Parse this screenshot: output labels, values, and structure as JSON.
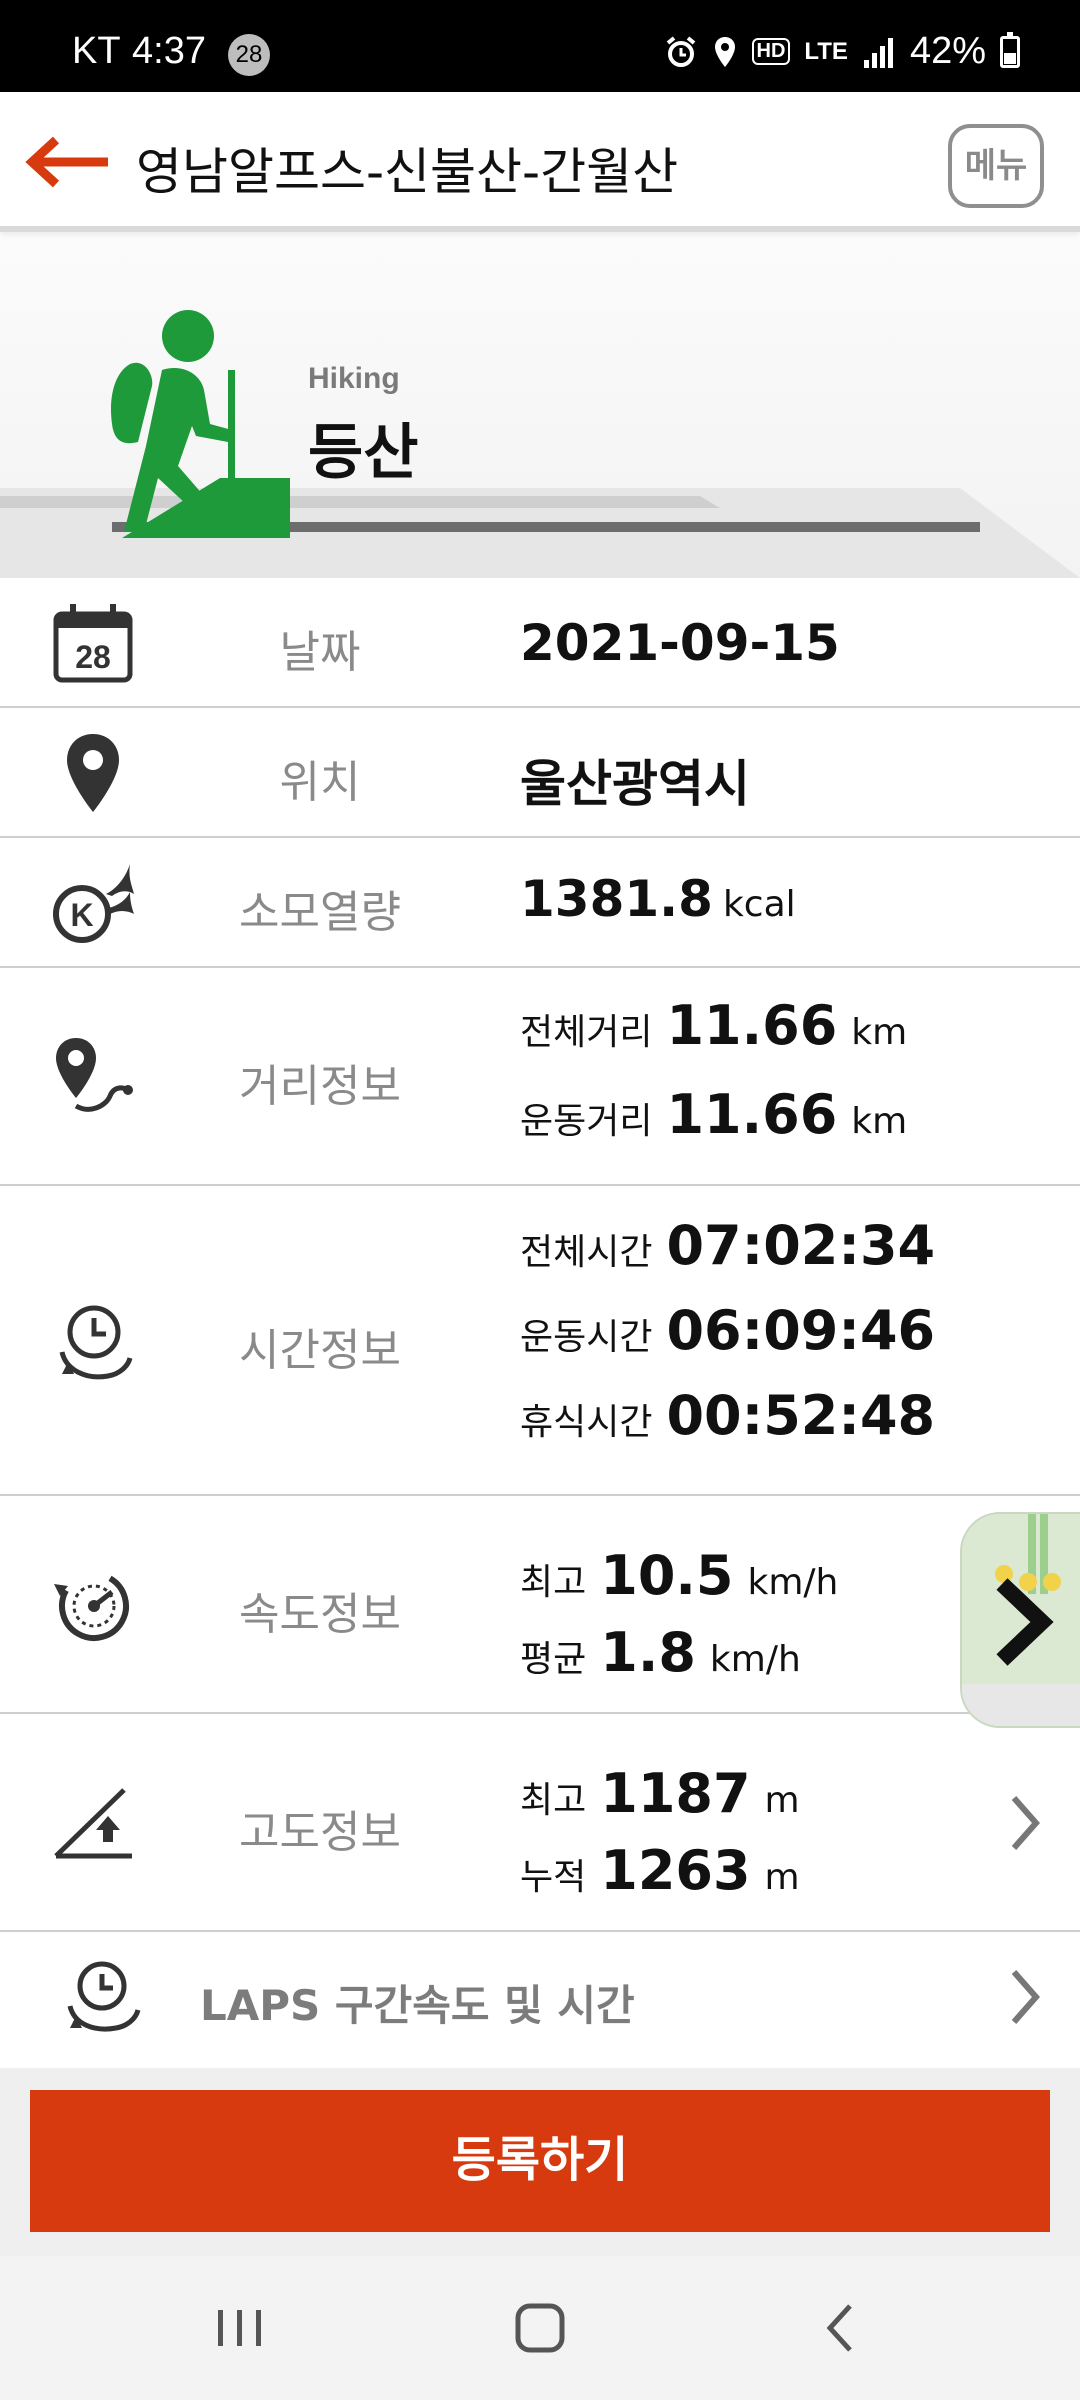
{
  "status_bar": {
    "carrier": "KT",
    "time": "4:37",
    "notification_count": "28",
    "network": "LTE",
    "battery": "42%",
    "icons": [
      "alarm-icon",
      "location-icon",
      "hd-voice-icon",
      "lte-icon",
      "signal-icon",
      "battery-icon"
    ]
  },
  "header": {
    "title": "영남알프스-신불산-간월산",
    "menu_label": "메뉴",
    "back_icon": "back-arrow-icon"
  },
  "activity": {
    "english": "Hiking",
    "korean": "등산",
    "icon": "hiker-icon"
  },
  "rows": {
    "date": {
      "label": "날짜",
      "value": "2021-09-15",
      "icon": "calendar-icon",
      "icon_text": "28"
    },
    "location": {
      "label": "위치",
      "value": "울산광역시",
      "icon": "location-pin-icon"
    },
    "calories": {
      "label": "소모열량",
      "value": "1381.8",
      "unit": "kcal",
      "icon": "calorie-burn-icon",
      "icon_text": "K"
    },
    "distance": {
      "label": "거리정보",
      "icon": "route-icon",
      "total_label": "전체거리",
      "total_value": "11.66",
      "total_unit": "km",
      "moving_label": "운동거리",
      "moving_value": "11.66",
      "moving_unit": "km"
    },
    "time": {
      "label": "시간정보",
      "icon": "clock-cycle-icon",
      "total_label": "전체시간",
      "total_value": "07:02:34",
      "moving_label": "운동시간",
      "moving_value": "06:09:46",
      "rest_label": "휴식시간",
      "rest_value": "00:52:48"
    },
    "speed": {
      "label": "속도정보",
      "icon": "speedometer-icon",
      "max_label": "최고",
      "max_value": "10.5",
      "max_unit": "km/h",
      "avg_label": "평균",
      "avg_value": "1.8",
      "avg_unit": "km/h"
    },
    "altitude": {
      "label": "고도정보",
      "icon": "altitude-icon",
      "max_label": "최고",
      "max_value": "1187",
      "max_unit": "m",
      "cumulative_label": "누적",
      "cumulative_value": "1263",
      "cumulative_unit": "m"
    },
    "laps": {
      "label": "LAPS 구간속도 및 시간",
      "icon": "laps-clock-icon"
    }
  },
  "map_preview": {
    "icon": "map-thumbnail-icon"
  },
  "register_label": "등록하기",
  "colors": {
    "accent": "#d83a0f",
    "hiker_green": "#1f9a3a",
    "label_gray": "#8a8a8a"
  },
  "nav": {
    "recent": "recent-apps-icon",
    "home": "home-icon",
    "back": "nav-back-icon"
  }
}
